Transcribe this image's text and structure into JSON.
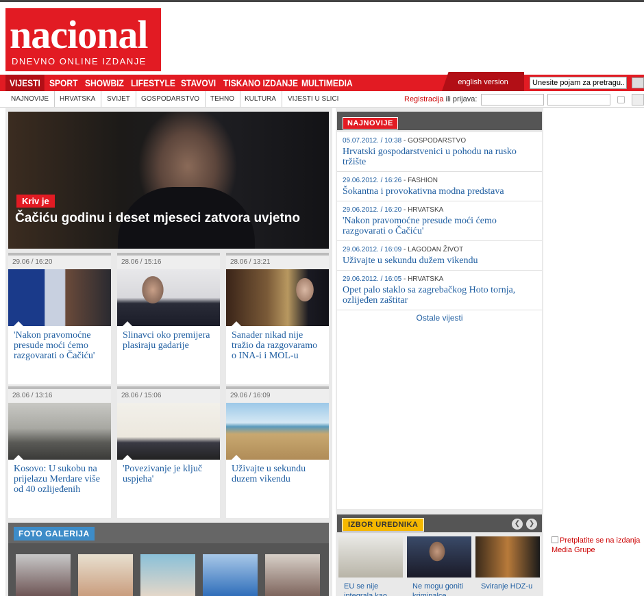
{
  "logo": {
    "name": "nacional",
    "tagline": "DNEVNO ONLINE IZDANJE"
  },
  "main_nav": [
    "VIJESTI",
    "SPORT",
    "SHOWBIZ",
    "LIFESTYLE",
    "STAVOVI",
    "TISKANO IZDANJE",
    "MULTIMEDIA"
  ],
  "english_version": "english version",
  "search": {
    "value": "Unesite pojam za pretragu..."
  },
  "sub_nav": [
    "NAJNOVIJE",
    "HRVATSKA",
    "SVIJET",
    "GOSPODARSTVO",
    "TEHNO",
    "KULTURA",
    "VIJESTI U SLICI"
  ],
  "login": {
    "register": "Registracija",
    "or_login": "ili prijava:"
  },
  "hero": {
    "tag": "Kriv je",
    "title": "Čačiću godinu i deset mjeseci zatvora uvjetno"
  },
  "cards": [
    {
      "date": "29.06 / 16:20",
      "title": "'Nakon pravomoćne presude moći ćemo razgovarati o Čačiću'"
    },
    {
      "date": "28.06 / 15:16",
      "title": "Slinavci oko premijera plasiraju gadarije"
    },
    {
      "date": "28.06 / 13:21",
      "title": "Sanader nikad nije tražio da razgovaramo o INA-i i MOL-u"
    },
    {
      "date": "28.06 / 13:16",
      "title": "Kosovo: U sukobu na prijelazu Merdare više od 40 ozlijeđenih"
    },
    {
      "date": "28.06 / 15:06",
      "title": "'Povezivanje je ključ uspjeha'"
    },
    {
      "date": "29.06 / 16:09",
      "title": "Uživajte u sekundu duzem vikendu"
    }
  ],
  "gallery": {
    "title": "FOTO GALERIJA"
  },
  "najnovije": {
    "title": "NAJNOVIJE",
    "items": [
      {
        "date": "05.07.2012. / 10:38",
        "cat": "GOSPODARSTVO",
        "title": "Hrvatski gospodarstvenici u pohodu na rusko tržište"
      },
      {
        "date": "29.06.2012. / 16:26",
        "cat": "FASHION",
        "title": "Šokantna i provokativna modna predstava"
      },
      {
        "date": "29.06.2012. / 16:20",
        "cat": "HRVATSKA",
        "title": "'Nakon pravomoćne presude moći ćemo razgovarati o Čačiću'"
      },
      {
        "date": "29.06.2012. / 16:09",
        "cat": "LAGODAN ŽIVOT",
        "title": "Uživajte u sekundu dužem vikendu"
      },
      {
        "date": "29.06.2012. / 16:05",
        "cat": "HRVATSKA",
        "title": "Opet palo staklo sa zagrebačkog Hoto tornja, ozlijeđen zaštitar"
      }
    ],
    "more": "Ostale vijesti"
  },
  "izbor": {
    "title": "IZBOR UREDNIKA",
    "items": [
      "EU se nije integrala kao",
      "Ne mogu goniti kriminalce",
      "Sviranje HDZ-u"
    ]
  },
  "ad": {
    "text": "Pretplatite se na izdanja Media Grupe"
  },
  "colors": {
    "brand_red": "#e21b23",
    "link_blue": "#1f5ea1",
    "gallery_blue": "#3d8cc8",
    "izbor_yellow": "#f5b800"
  }
}
